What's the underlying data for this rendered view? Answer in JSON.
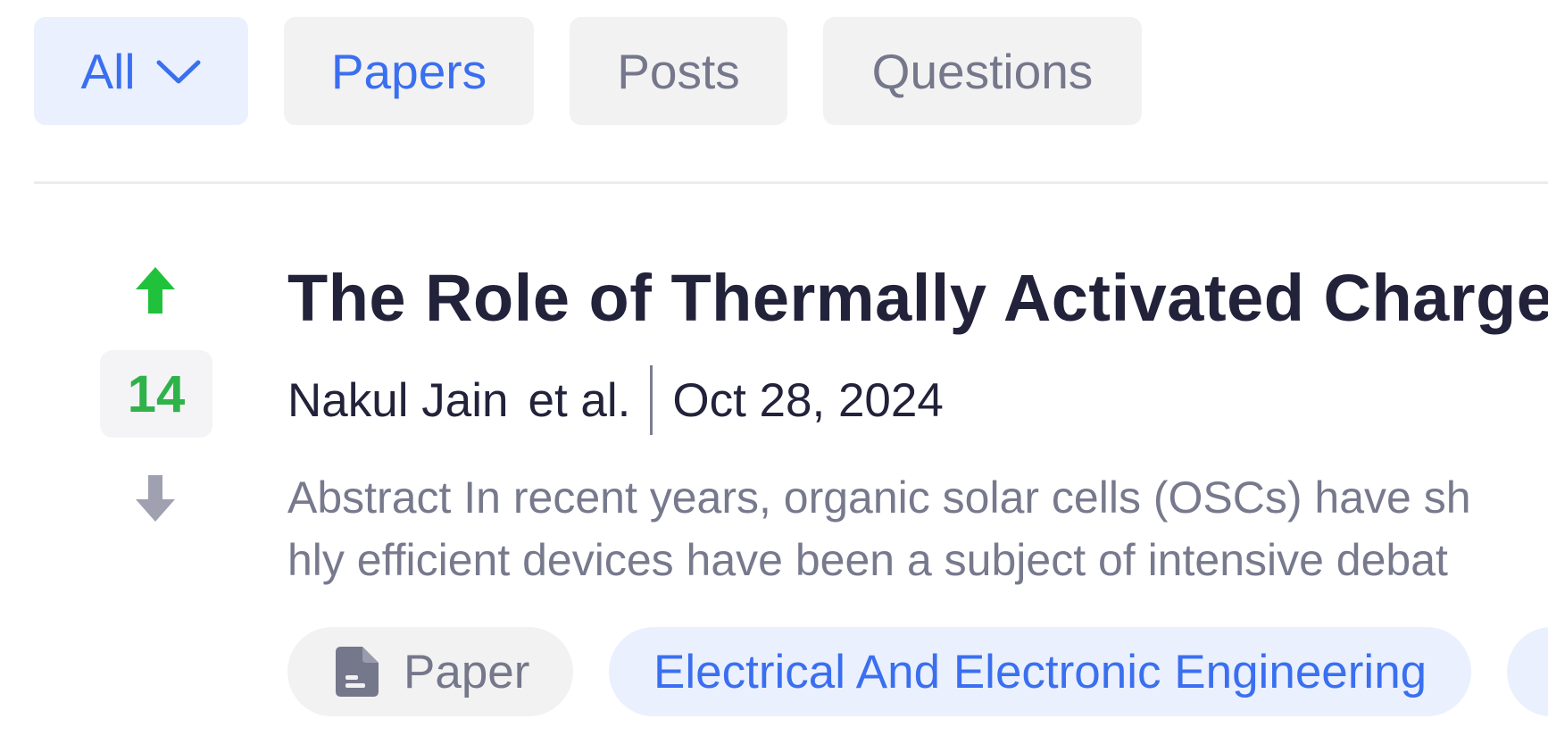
{
  "filters": {
    "all": {
      "label": "All"
    },
    "papers": {
      "label": "Papers"
    },
    "posts": {
      "label": "Posts"
    },
    "questions": {
      "label": "Questions"
    },
    "active": "All"
  },
  "result": {
    "vote_count": "14",
    "title": "The Role of Thermally Activated Charge",
    "author": "Nakul Jain",
    "et_al": "et al.",
    "date": "Oct 28, 2024",
    "abstract_lines": [
      "Abstract In recent years, organic solar cells (OSCs) have sh",
      "hly efficient devices have been a subject of intensive debat"
    ],
    "type_tag": "Paper",
    "topic_tag": "Electrical And Electronic Engineering"
  },
  "colors": {
    "accent": "#3a6ff0",
    "upvote": "#1fc23a",
    "count": "#2fb24a",
    "downvote": "#9fa0b0",
    "title": "#22223a",
    "muted": "#75778b"
  },
  "icons": {
    "filter_dropdown": "chevron-down-icon",
    "upvote": "arrow-up-icon",
    "downvote": "arrow-down-icon",
    "type": "document-icon"
  }
}
